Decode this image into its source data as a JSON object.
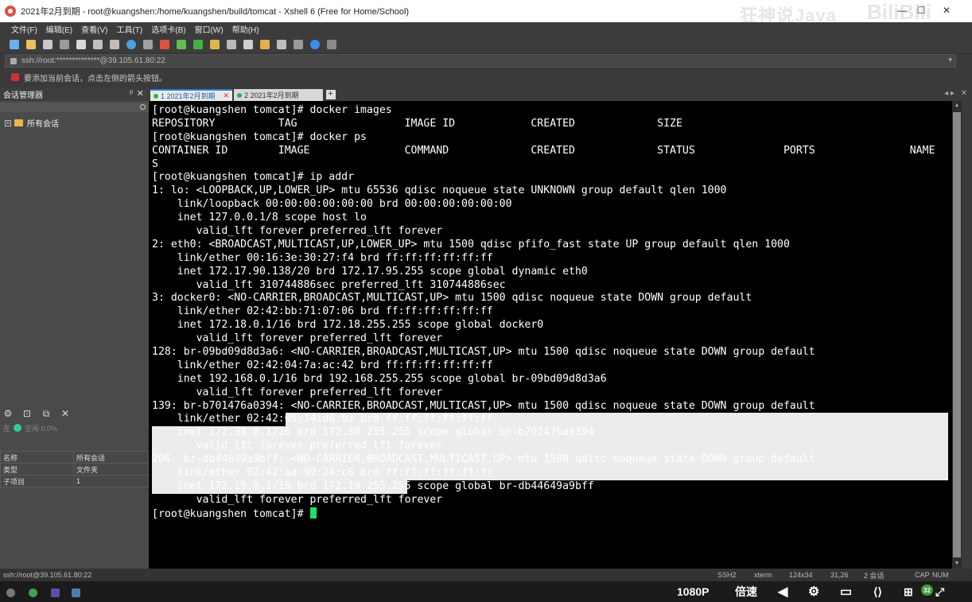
{
  "window": {
    "title": "2021年2月到期 - root@kuangshen:/home/kuangshen/build/tomcat - Xshell 6 (Free for Home/School)",
    "watermark_left": "狂神说Java",
    "watermark_right": "BiliBili",
    "controls": {
      "minimize": "—",
      "maximize": "☐",
      "close": "✕"
    }
  },
  "menu": {
    "items": [
      "文件(F)",
      "编辑(E)",
      "查看(V)",
      "工具(T)",
      "选项卡(B)",
      "窗口(W)",
      "帮助(H)"
    ]
  },
  "address_bar": {
    "value": "ssh://root:**************@39.105.61.80:22"
  },
  "hint_bar": {
    "text": "要添加当前会话，点击左侧的箭头按钮。"
  },
  "session_panel": {
    "title": "会话管理器",
    "pin": "ᵖ",
    "close": "✕",
    "tree_root": "所有会话",
    "status_labels": [
      "在",
      "空闲 0.0%"
    ],
    "properties": [
      {
        "key": "名称",
        "value": "所有会话"
      },
      {
        "key": "类型",
        "value": "文件夹"
      },
      {
        "key": "子项目",
        "value": "1"
      }
    ]
  },
  "tabs": [
    {
      "label": "1 2021年2月到期",
      "active": true
    },
    {
      "label": "2 2021年2月到期",
      "active": false
    }
  ],
  "terminal": {
    "lines": [
      "[root@kuangshen tomcat]# docker images",
      "REPOSITORY          TAG                 IMAGE ID            CREATED             SIZE",
      "[root@kuangshen tomcat]# docker ps",
      "CONTAINER ID        IMAGE               COMMAND             CREATED             STATUS              PORTS               NAME",
      "S",
      "[root@kuangshen tomcat]# ip addr",
      "1: lo: <LOOPBACK,UP,LOWER_UP> mtu 65536 qdisc noqueue state UNKNOWN group default qlen 1000",
      "    link/loopback 00:00:00:00:00:00 brd 00:00:00:00:00:00",
      "    inet 127.0.0.1/8 scope host lo",
      "       valid_lft forever preferred_lft forever",
      "2: eth0: <BROADCAST,MULTICAST,UP,LOWER_UP> mtu 1500 qdisc pfifo_fast state UP group default qlen 1000",
      "    link/ether 00:16:3e:30:27:f4 brd ff:ff:ff:ff:ff:ff",
      "    inet 172.17.90.138/20 brd 172.17.95.255 scope global dynamic eth0",
      "       valid_lft 310744886sec preferred_lft 310744886sec",
      "3: docker0: <NO-CARRIER,BROADCAST,MULTICAST,UP> mtu 1500 qdisc noqueue state DOWN group default",
      "    link/ether 02:42:bb:71:07:06 brd ff:ff:ff:ff:ff:ff",
      "    inet 172.18.0.1/16 brd 172.18.255.255 scope global docker0",
      "       valid_lft forever preferred_lft forever",
      "128: br-09bd09d8d3a6: <NO-CARRIER,BROADCAST,MULTICAST,UP> mtu 1500 qdisc noqueue state DOWN group default",
      "    link/ether 02:42:04:7a:ac:42 brd ff:ff:ff:ff:ff:ff",
      "    inet 192.168.0.1/16 brd 192.168.255.255 scope global br-09bd09d8d3a6",
      "       valid_lft forever preferred_lft forever",
      "139: br-b701476a0394: <NO-CARRIER,BROADCAST,MULTICAST,UP> mtu 1500 qdisc noqueue state DOWN group default",
      "    link/ether 02:42:05:14:d6:b3 brd ff:ff:ff:ff:ff:ff",
      "    inet 172.38.0.1/16 brd 172.38.255.255 scope global br-b701476a0394",
      "       valid_lft forever preferred_lft forever",
      "206: br-db44649a9bff: <NO-CARRIER,BROADCAST,MULTICAST,UP> mtu 1500 qdisc noqueue state DOWN group default",
      "    link/ether 02:42:ad:99:24:c6 brd ff:ff:ff:ff:ff:ff",
      "    inet 172.19.0.1/16 brd 172.19.255.255 scope global br-db44649a9bff",
      "       valid_lft forever preferred_lft forever"
    ],
    "prompt": "[root@kuangshen tomcat]# ",
    "colors": {
      "background": "#000000",
      "foreground": "#ffffff",
      "cursor": "#19e36a",
      "selection": "#ececec"
    }
  },
  "status_bar": {
    "connection": "ssh://root@39.105.61.80:22",
    "protocol": "SSH2",
    "terminal_type": "xterm",
    "size": "124x34",
    "cursor_pos": "31,26",
    "sessions": "2 会话",
    "cap": "CAP",
    "num": "NUM"
  },
  "video_overlay": {
    "quality": "1080P",
    "speed": "倍速",
    "badge": "32"
  }
}
